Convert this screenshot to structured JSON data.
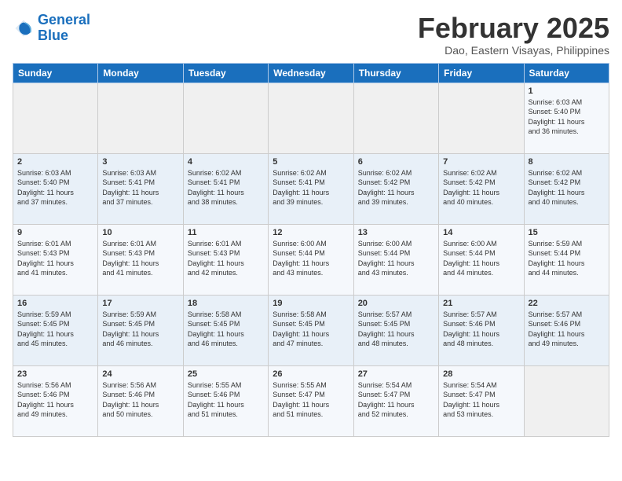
{
  "logo": {
    "line1": "General",
    "line2": "Blue"
  },
  "title": "February 2025",
  "subtitle": "Dao, Eastern Visayas, Philippines",
  "days_of_week": [
    "Sunday",
    "Monday",
    "Tuesday",
    "Wednesday",
    "Thursday",
    "Friday",
    "Saturday"
  ],
  "weeks": [
    [
      {
        "day": "",
        "info": ""
      },
      {
        "day": "",
        "info": ""
      },
      {
        "day": "",
        "info": ""
      },
      {
        "day": "",
        "info": ""
      },
      {
        "day": "",
        "info": ""
      },
      {
        "day": "",
        "info": ""
      },
      {
        "day": "1",
        "info": "Sunrise: 6:03 AM\nSunset: 5:40 PM\nDaylight: 11 hours\nand 36 minutes."
      }
    ],
    [
      {
        "day": "2",
        "info": "Sunrise: 6:03 AM\nSunset: 5:40 PM\nDaylight: 11 hours\nand 37 minutes."
      },
      {
        "day": "3",
        "info": "Sunrise: 6:03 AM\nSunset: 5:41 PM\nDaylight: 11 hours\nand 37 minutes."
      },
      {
        "day": "4",
        "info": "Sunrise: 6:02 AM\nSunset: 5:41 PM\nDaylight: 11 hours\nand 38 minutes."
      },
      {
        "day": "5",
        "info": "Sunrise: 6:02 AM\nSunset: 5:41 PM\nDaylight: 11 hours\nand 39 minutes."
      },
      {
        "day": "6",
        "info": "Sunrise: 6:02 AM\nSunset: 5:42 PM\nDaylight: 11 hours\nand 39 minutes."
      },
      {
        "day": "7",
        "info": "Sunrise: 6:02 AM\nSunset: 5:42 PM\nDaylight: 11 hours\nand 40 minutes."
      },
      {
        "day": "8",
        "info": "Sunrise: 6:02 AM\nSunset: 5:42 PM\nDaylight: 11 hours\nand 40 minutes."
      }
    ],
    [
      {
        "day": "9",
        "info": "Sunrise: 6:01 AM\nSunset: 5:43 PM\nDaylight: 11 hours\nand 41 minutes."
      },
      {
        "day": "10",
        "info": "Sunrise: 6:01 AM\nSunset: 5:43 PM\nDaylight: 11 hours\nand 41 minutes."
      },
      {
        "day": "11",
        "info": "Sunrise: 6:01 AM\nSunset: 5:43 PM\nDaylight: 11 hours\nand 42 minutes."
      },
      {
        "day": "12",
        "info": "Sunrise: 6:00 AM\nSunset: 5:44 PM\nDaylight: 11 hours\nand 43 minutes."
      },
      {
        "day": "13",
        "info": "Sunrise: 6:00 AM\nSunset: 5:44 PM\nDaylight: 11 hours\nand 43 minutes."
      },
      {
        "day": "14",
        "info": "Sunrise: 6:00 AM\nSunset: 5:44 PM\nDaylight: 11 hours\nand 44 minutes."
      },
      {
        "day": "15",
        "info": "Sunrise: 5:59 AM\nSunset: 5:44 PM\nDaylight: 11 hours\nand 44 minutes."
      }
    ],
    [
      {
        "day": "16",
        "info": "Sunrise: 5:59 AM\nSunset: 5:45 PM\nDaylight: 11 hours\nand 45 minutes."
      },
      {
        "day": "17",
        "info": "Sunrise: 5:59 AM\nSunset: 5:45 PM\nDaylight: 11 hours\nand 46 minutes."
      },
      {
        "day": "18",
        "info": "Sunrise: 5:58 AM\nSunset: 5:45 PM\nDaylight: 11 hours\nand 46 minutes."
      },
      {
        "day": "19",
        "info": "Sunrise: 5:58 AM\nSunset: 5:45 PM\nDaylight: 11 hours\nand 47 minutes."
      },
      {
        "day": "20",
        "info": "Sunrise: 5:57 AM\nSunset: 5:45 PM\nDaylight: 11 hours\nand 48 minutes."
      },
      {
        "day": "21",
        "info": "Sunrise: 5:57 AM\nSunset: 5:46 PM\nDaylight: 11 hours\nand 48 minutes."
      },
      {
        "day": "22",
        "info": "Sunrise: 5:57 AM\nSunset: 5:46 PM\nDaylight: 11 hours\nand 49 minutes."
      }
    ],
    [
      {
        "day": "23",
        "info": "Sunrise: 5:56 AM\nSunset: 5:46 PM\nDaylight: 11 hours\nand 49 minutes."
      },
      {
        "day": "24",
        "info": "Sunrise: 5:56 AM\nSunset: 5:46 PM\nDaylight: 11 hours\nand 50 minutes."
      },
      {
        "day": "25",
        "info": "Sunrise: 5:55 AM\nSunset: 5:46 PM\nDaylight: 11 hours\nand 51 minutes."
      },
      {
        "day": "26",
        "info": "Sunrise: 5:55 AM\nSunset: 5:47 PM\nDaylight: 11 hours\nand 51 minutes."
      },
      {
        "day": "27",
        "info": "Sunrise: 5:54 AM\nSunset: 5:47 PM\nDaylight: 11 hours\nand 52 minutes."
      },
      {
        "day": "28",
        "info": "Sunrise: 5:54 AM\nSunset: 5:47 PM\nDaylight: 11 hours\nand 53 minutes."
      },
      {
        "day": "",
        "info": ""
      }
    ]
  ]
}
